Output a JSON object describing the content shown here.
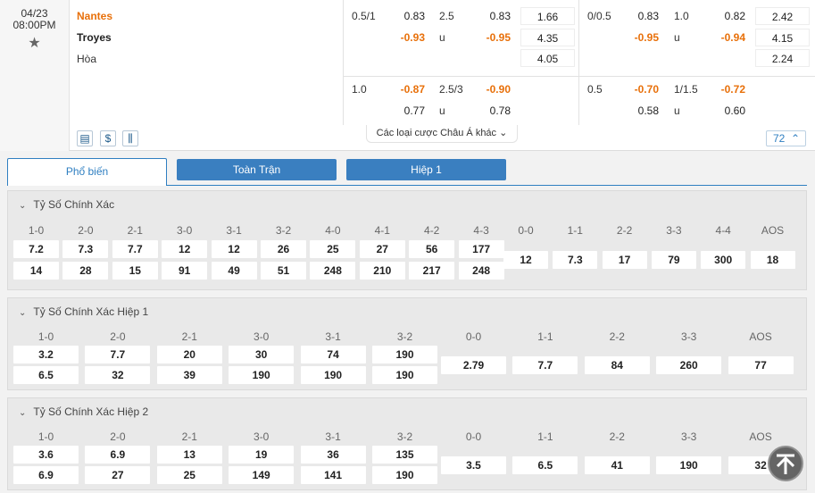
{
  "match": {
    "date": "04/23",
    "time": "08:00PM",
    "home": "Nantes",
    "away": "Troyes",
    "draw": "Hòa",
    "markets_more": "Các loại cược Châu Á khác",
    "markets_count": "72"
  },
  "odds_rows": [
    {
      "hcap_line": "0.5/1",
      "hcap_home": "0.83",
      "hcap_away": "-0.93",
      "ou_line": "2.5",
      "ou_over": "0.83",
      "ou_u": "u",
      "ou_under": "-0.95",
      "x12_home": "1.66",
      "x12_away": "4.35",
      "x12_draw": "4.05",
      "h1_hcap_line": "0/0.5",
      "h1_hcap_home": "0.83",
      "h1_hcap_away": "-0.95",
      "h1_ou_line": "1.0",
      "h1_ou_over": "0.82",
      "h1_ou_u": "u",
      "h1_ou_under": "-0.94",
      "h1_x12_home": "2.42",
      "h1_x12_away": "4.15",
      "h1_x12_draw": "2.24"
    },
    {
      "hcap_line": "1.0",
      "hcap_home": "-0.87",
      "hcap_away": "0.77",
      "ou_line": "2.5/3",
      "ou_over": "-0.90",
      "ou_u": "u",
      "ou_under": "0.78",
      "h1_hcap_line": "0.5",
      "h1_hcap_home": "-0.70",
      "h1_hcap_away": "0.58",
      "h1_ou_line": "1/1.5",
      "h1_ou_over": "-0.72",
      "h1_ou_u": "u",
      "h1_ou_under": "0.60"
    }
  ],
  "tabs": [
    "Phổ biến",
    "Toàn Trận",
    "Hiệp 1"
  ],
  "sections": [
    {
      "title": "Tỷ Số Chính Xác",
      "left_headers": [
        "1-0",
        "2-0",
        "2-1",
        "3-0",
        "3-1",
        "3-2",
        "4-0",
        "4-1",
        "4-2",
        "4-3"
      ],
      "left_top": [
        "7.2",
        "7.3",
        "7.7",
        "12",
        "12",
        "26",
        "25",
        "27",
        "56",
        "177"
      ],
      "left_bottom": [
        "14",
        "28",
        "15",
        "91",
        "49",
        "51",
        "248",
        "210",
        "217",
        "248"
      ],
      "right_headers": [
        "0-0",
        "1-1",
        "2-2",
        "3-3",
        "4-4",
        "AOS"
      ],
      "right_values": [
        "12",
        "7.3",
        "17",
        "79",
        "300",
        "18"
      ]
    },
    {
      "title": "Tỷ Số Chính Xác Hiệp 1",
      "left_headers": [
        "1-0",
        "2-0",
        "2-1",
        "3-0",
        "3-1",
        "3-2"
      ],
      "left_top": [
        "3.2",
        "7.7",
        "20",
        "30",
        "74",
        "190"
      ],
      "left_bottom": [
        "6.5",
        "32",
        "39",
        "190",
        "190",
        "190"
      ],
      "right_headers": [
        "0-0",
        "1-1",
        "2-2",
        "3-3",
        "AOS"
      ],
      "right_values": [
        "2.79",
        "7.7",
        "84",
        "260",
        "77"
      ]
    },
    {
      "title": "Tỷ Số Chính Xác Hiệp 2",
      "left_headers": [
        "1-0",
        "2-0",
        "2-1",
        "3-0",
        "3-1",
        "3-2"
      ],
      "left_top": [
        "3.6",
        "6.9",
        "13",
        "19",
        "36",
        "135"
      ],
      "left_bottom": [
        "6.9",
        "27",
        "25",
        "149",
        "141",
        "190"
      ],
      "right_headers": [
        "0-0",
        "1-1",
        "2-2",
        "3-3",
        "AOS"
      ],
      "right_values": [
        "3.5",
        "6.5",
        "41",
        "190",
        "32"
      ]
    }
  ],
  "colors": {
    "accent": "#2f7fc1",
    "tab_blue": "#3a7fc0",
    "home_team": "#e8700a",
    "negative_odds": "#e8700a"
  }
}
